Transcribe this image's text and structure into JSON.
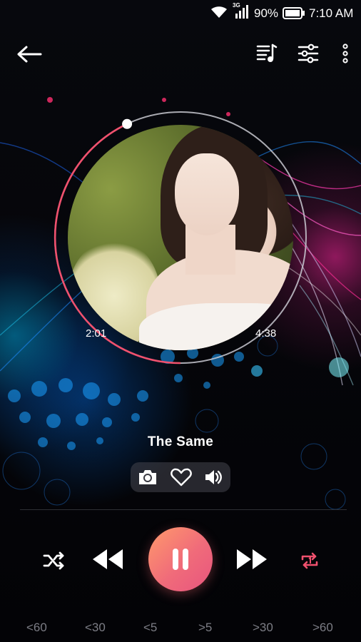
{
  "status_bar": {
    "network": "3G",
    "battery": "90%",
    "time": "7:10 AM",
    "icons": [
      "wifi-icon",
      "signal-icon",
      "battery-icon"
    ]
  },
  "toolbar": {
    "icons": [
      "back-arrow-icon",
      "playlist-icon",
      "equalizer-icon",
      "more-vert-icon"
    ]
  },
  "player": {
    "elapsed": "2:01",
    "duration": "4:38",
    "progress_fraction": 0.43,
    "song_title": "The Same",
    "actions": [
      "camera-icon",
      "heart-icon",
      "volume-icon"
    ]
  },
  "controls": {
    "icons": [
      "shuffle-icon",
      "rewind-icon",
      "pause-icon",
      "fast-forward-icon",
      "repeat-one-icon"
    ],
    "repeat_color": "#f0516e",
    "play_gradient": [
      "#ff9a6b",
      "#e8557e"
    ]
  },
  "seek_buttons": [
    "<60",
    "<30",
    "<5",
    ">5",
    ">30",
    ">60"
  ]
}
